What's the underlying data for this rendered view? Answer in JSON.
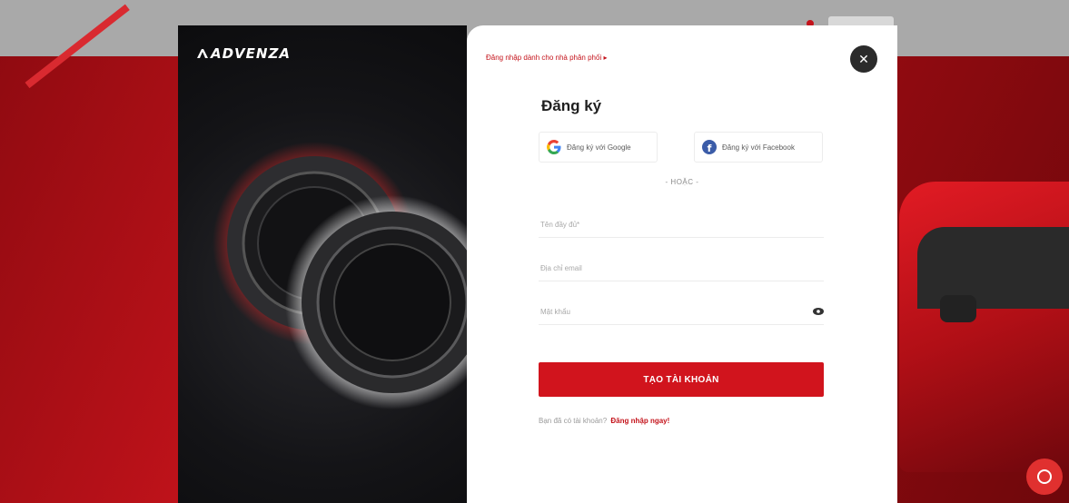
{
  "brand": {
    "logo_text": "ADVENZA"
  },
  "modal": {
    "distributor_link": "Đăng nhập dành cho nhà phân phối ▸",
    "title": "Đăng ký",
    "social": {
      "google_label": "Đăng ký với Google",
      "facebook_label": "Đăng ký với Facebook"
    },
    "divider": "- HOẶC -",
    "fields": {
      "full_name_placeholder": "Tên đầy đủ*",
      "email_placeholder": "Địa chỉ email",
      "password_placeholder": "Mật khẩu"
    },
    "submit_label": "TẠO TÀI KHOẢN",
    "login_prompt": "Bạn đã có tài khoản?",
    "login_link": "Đăng nhập ngay!"
  },
  "colors": {
    "accent": "#d1141d",
    "facebook": "#3b5ca8",
    "dark_panel": "#141417"
  },
  "icons": {
    "close": "close-icon",
    "google": "google-icon",
    "facebook": "facebook-icon",
    "eye": "eye-icon",
    "chat": "chat-icon"
  }
}
